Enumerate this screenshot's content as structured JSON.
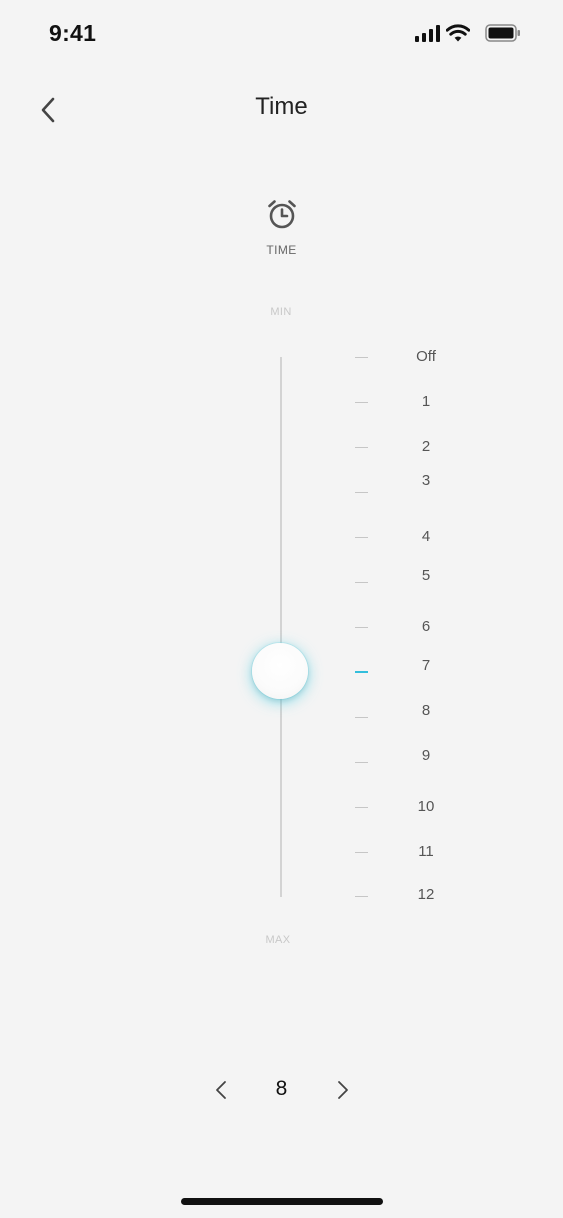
{
  "status_bar": {
    "time": "9:41",
    "icons": [
      "cellular-signal-icon",
      "wifi-icon",
      "battery-icon"
    ]
  },
  "nav": {
    "title": "Time",
    "back_icon": "chevron-left-icon"
  },
  "mode": {
    "icon": "alarm-clock-icon",
    "label": "TIME"
  },
  "slider": {
    "min_label": "MIN",
    "max_label": "MAX",
    "selected": "7",
    "accent_color": "#33bedc",
    "scale": [
      "Off",
      "1",
      "2",
      "3",
      "4",
      "5",
      "6",
      "7",
      "8",
      "9",
      "10",
      "11",
      "12"
    ]
  },
  "stepper": {
    "value": "8",
    "prev_icon": "chevron-left-icon",
    "next_icon": "chevron-right-icon"
  }
}
